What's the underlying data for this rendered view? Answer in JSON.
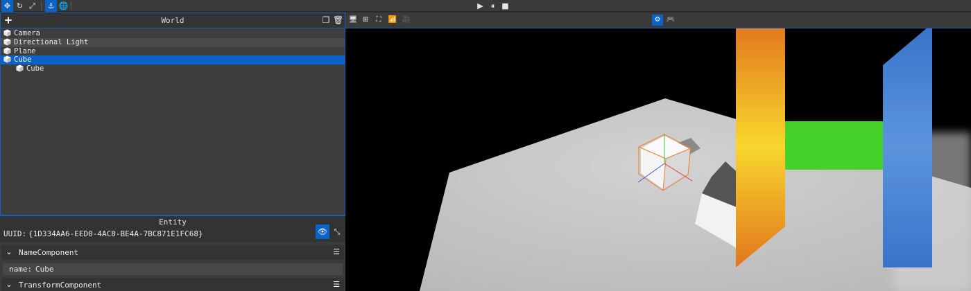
{
  "toolbar": {
    "gizmo_buttons": [
      {
        "name": "translate-icon",
        "glyph": "✥",
        "active": true
      },
      {
        "name": "rotate-icon",
        "glyph": "↻",
        "active": false
      },
      {
        "name": "scale-icon",
        "glyph": "⤢",
        "active": false
      }
    ],
    "space_buttons": [
      {
        "name": "local-space-icon",
        "glyph": "⚓",
        "active": true
      },
      {
        "name": "world-space-icon",
        "glyph": "🌐",
        "active": false
      }
    ],
    "playback": [
      {
        "name": "play-icon",
        "glyph": "▶"
      },
      {
        "name": "pause-icon",
        "glyph": "⏸"
      },
      {
        "name": "stop-icon",
        "glyph": "■"
      }
    ]
  },
  "world_panel": {
    "title": "World",
    "add_glyph": "+",
    "duplicate_glyph": "❐",
    "delete_glyph": "🗑",
    "entities": [
      {
        "label": "Camera",
        "depth": 0,
        "selected": false
      },
      {
        "label": "Directional Light",
        "depth": 0,
        "selected": false
      },
      {
        "label": "Plane",
        "depth": 0,
        "selected": false
      },
      {
        "label": "Cube",
        "depth": 0,
        "selected": true
      },
      {
        "label": "Cube",
        "depth": 1,
        "selected": false
      }
    ]
  },
  "entity_panel": {
    "title": "Entity",
    "uuid_label": "UUID:",
    "uuid_value": "{1D334AA6-EED0-4AC8-BE4A-7BC871E1FC68}",
    "visibility_glyph": "👁",
    "collapse_glyph": "⤡",
    "components": [
      {
        "title": "NameComponent",
        "chevron": "⌄",
        "menu": "☰"
      },
      {
        "title": "TransformComponent",
        "chevron": "⌄",
        "menu": "☰"
      }
    ],
    "name_field": {
      "label": "name:",
      "value": "Cube"
    }
  },
  "viewport_toolbar": {
    "left_buttons": [
      {
        "name": "display-icon",
        "glyph": "🖥"
      },
      {
        "name": "grid-icon",
        "glyph": "⊞"
      },
      {
        "name": "frame-icon",
        "glyph": "⛶"
      },
      {
        "name": "stats-icon",
        "glyph": "📶"
      },
      {
        "name": "camera-icon",
        "glyph": "🎥"
      }
    ],
    "right_buttons": [
      {
        "name": "scene-camera-icon",
        "glyph": "⚙",
        "active": true
      },
      {
        "name": "gamepad-icon",
        "glyph": "🎮",
        "active": false
      }
    ]
  },
  "scene": {
    "background_color": "#000000",
    "plane_color": "#c6c6c6",
    "selection_color": "#f07a2a",
    "axis_colors": {
      "x": "#e23b3b",
      "y": "#3ec23e",
      "z": "#3a5de0"
    },
    "bars": [
      {
        "name": "orange-bar",
        "color_top": "#e1761c",
        "color_mid": "#f8d72e"
      },
      {
        "name": "green-bar",
        "color": "#47d12b"
      },
      {
        "name": "blue-bar",
        "color_top": "#3a72c9",
        "color_mid": "#5b94dd"
      }
    ]
  }
}
